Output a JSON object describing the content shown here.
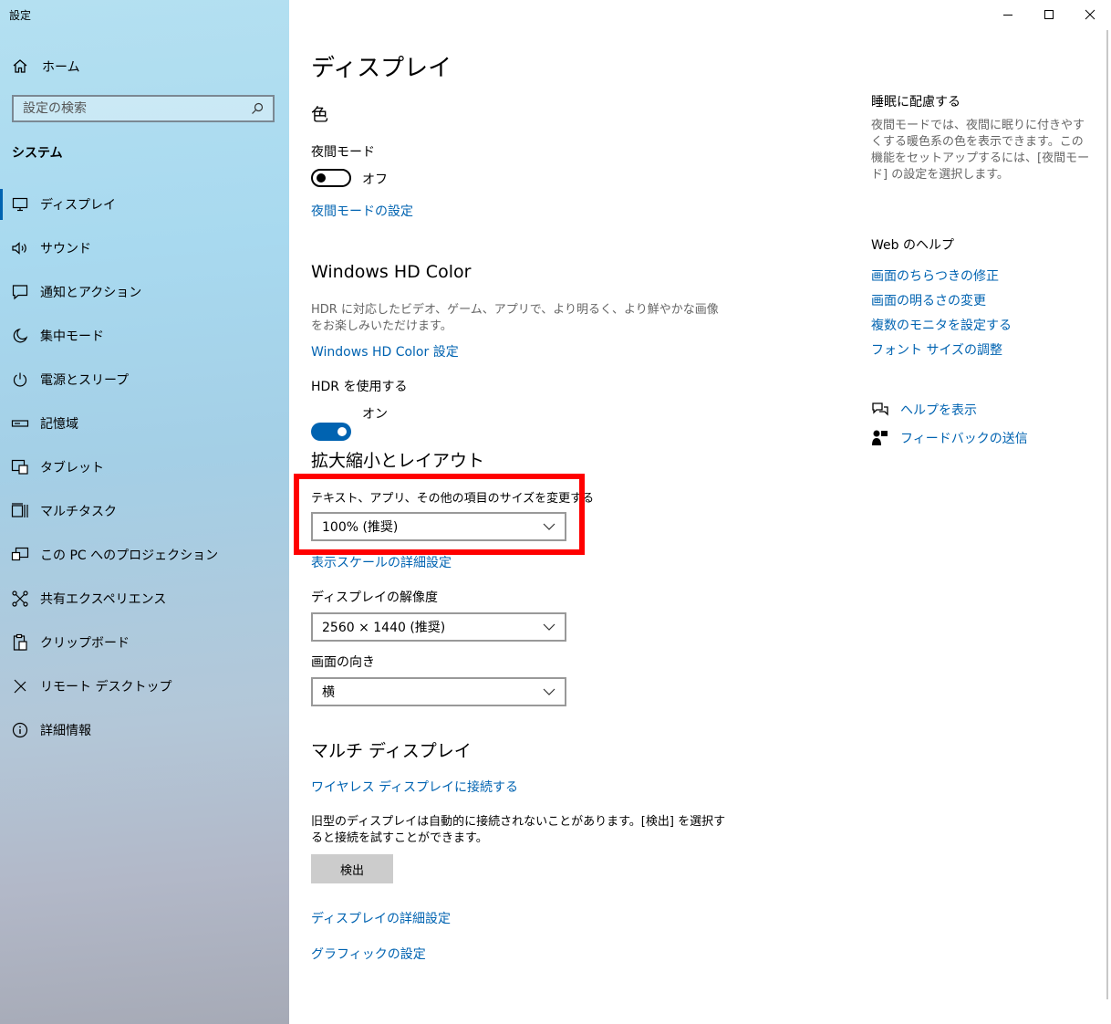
{
  "window": {
    "title": "設定"
  },
  "sidebar": {
    "home_label": "ホーム",
    "search_placeholder": "設定の検索",
    "section_title": "システム",
    "items": [
      {
        "label": "ディスプレイ",
        "icon": "monitor-icon",
        "active": true
      },
      {
        "label": "サウンド",
        "icon": "speaker-icon"
      },
      {
        "label": "通知とアクション",
        "icon": "message-icon"
      },
      {
        "label": "集中モード",
        "icon": "moon-icon"
      },
      {
        "label": "電源とスリープ",
        "icon": "power-icon"
      },
      {
        "label": "記憶域",
        "icon": "storage-icon"
      },
      {
        "label": "タブレット",
        "icon": "tablet-icon"
      },
      {
        "label": "マルチタスク",
        "icon": "multitask-icon"
      },
      {
        "label": "この PC へのプロジェクション",
        "icon": "projection-icon"
      },
      {
        "label": "共有エクスペリエンス",
        "icon": "share-icon"
      },
      {
        "label": "クリップボード",
        "icon": "clipboard-icon"
      },
      {
        "label": "リモート デスクトップ",
        "icon": "remote-icon"
      },
      {
        "label": "詳細情報",
        "icon": "info-icon"
      }
    ]
  },
  "main": {
    "page_title": "ディスプレイ",
    "color": {
      "heading": "色",
      "night_mode_label": "夜間モード",
      "night_mode_state": "オフ",
      "night_mode_link": "夜間モードの設定"
    },
    "hdr": {
      "heading": "Windows HD Color",
      "description": "HDR に対応したビデオ、ゲーム、アプリで、より明るく、より鮮やかな画像をお楽しみいただけます。",
      "link": "Windows HD Color 設定",
      "use_label": "HDR を使用する",
      "use_state": "オン"
    },
    "scale": {
      "heading": "拡大縮小とレイアウト",
      "size_label": "テキスト、アプリ、その他の項目のサイズを変更する",
      "size_value": "100% (推奨)",
      "advanced_link": "表示スケールの詳細設定",
      "resolution_label": "ディスプレイの解像度",
      "resolution_value": "2560 × 1440 (推奨)",
      "orientation_label": "画面の向き",
      "orientation_value": "横"
    },
    "multi": {
      "heading": "マルチ ディスプレイ",
      "wireless_link": "ワイヤレス ディスプレイに接続する",
      "description": "旧型のディスプレイは自動的に接続されないことがあります。[検出] を選択すると接続を試すことができます。",
      "detect_button": "検出",
      "advanced_link": "ディスプレイの詳細設定",
      "graphics_link": "グラフィックの設定"
    }
  },
  "right": {
    "sleep_heading": "睡眠に配慮する",
    "sleep_description": "夜間モードでは、夜間に眠りに付きやすくする暖色系の色を表示できます。この機能をセットアップするには、[夜間モード] の設定を選択します。",
    "web_help_heading": "Web のヘルプ",
    "web_links": [
      "画面のちらつきの修正",
      "画面の明るさの変更",
      "複数のモニタを設定する",
      "フォント サイズの調整"
    ],
    "help_link": "ヘルプを表示",
    "feedback_link": "フィードバックの送信"
  },
  "colors": {
    "accent": "#0063b1",
    "highlight": "#ff0000"
  }
}
